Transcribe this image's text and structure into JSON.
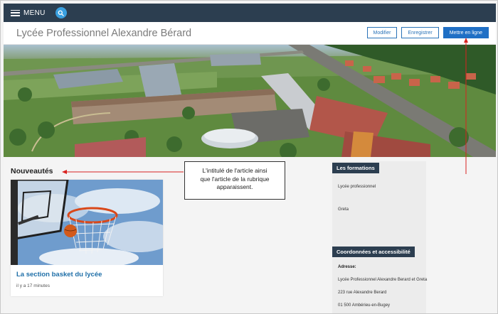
{
  "topbar": {
    "menu_label": "MENU",
    "search_icon": "search-icon"
  },
  "header": {
    "site_title": "Lycée Professionnel Alexandre Bérard",
    "buttons": {
      "modifier": "Modifier",
      "enregistrer": "Enregistrer",
      "publish": "Mettre en ligne"
    }
  },
  "news": {
    "heading": "Nouveautés",
    "article": {
      "title": "La section basket du lycée",
      "time": "il y a 17 minutes"
    }
  },
  "callout": {
    "line1": "L'intitulé de l'article ainsi",
    "line2": "que l'article de la rubrique",
    "line3": "apparaissent."
  },
  "sidebar": {
    "formations_heading": "Les formations",
    "formations": [
      "Lycée professionnel",
      "Greta"
    ],
    "contact_heading": "Coordonnées et accessibilité",
    "address_label": "Adresse:",
    "address_lines": [
      "Lycée Professionnel Alexandre Berard et Greta",
      "223 rue Alexandre Berard",
      "01 500 Ambérieu-en-Bugey"
    ]
  },
  "colors": {
    "topbar": "#2c3e50",
    "accent": "#1f6fc5",
    "annotation_arrow": "#d9221f",
    "link": "#1f6fa8"
  }
}
